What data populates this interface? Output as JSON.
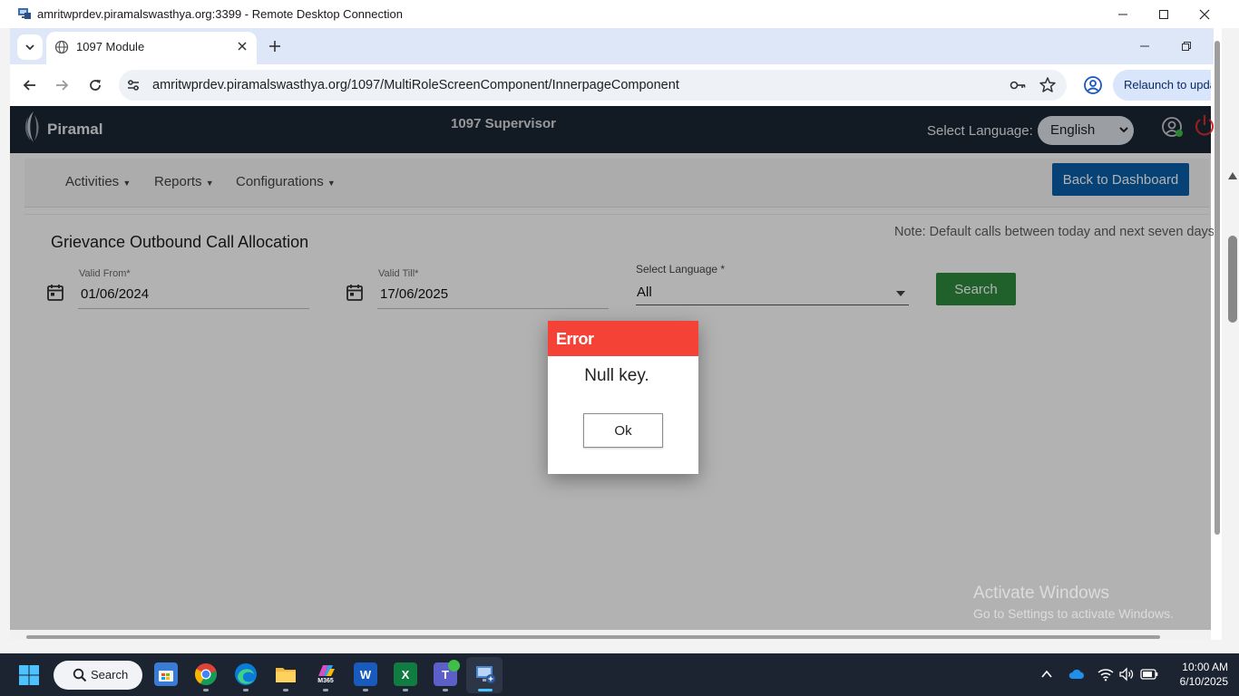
{
  "rdp": {
    "title": "amritwprdev.piramalswasthya.org:3399 - Remote Desktop Connection"
  },
  "browser": {
    "tab_title": "1097 Module",
    "url": "amritwprdev.piramalswasthya.org/1097/MultiRoleScreenComponent/InnerpageComponent",
    "relaunch_label": "Relaunch to update"
  },
  "header": {
    "logo_text": "Piramal",
    "app_title": "1097 Supervisor",
    "language_label": "Select Language:",
    "language_value": "English"
  },
  "menu": {
    "items": [
      "Activities",
      "Reports",
      "Configurations"
    ],
    "back_button": "Back to Dashboard"
  },
  "form": {
    "title": "Grievance Outbound Call Allocation",
    "note": "Note: Default calls between today and next seven days",
    "valid_from_label": "Valid From*",
    "valid_from_value": "01/06/2024",
    "valid_till_label": "Valid Till*",
    "valid_till_value": "17/06/2025",
    "language_label": "Select Language *",
    "language_value": "All",
    "search_button": "Search"
  },
  "dialog": {
    "title": "Error",
    "message": "Null key.",
    "ok_button": "Ok"
  },
  "watermark": {
    "title": "Activate Windows",
    "subtitle": "Go to Settings to activate Windows."
  },
  "taskbar": {
    "search_label": "Search",
    "m365_label": "M365",
    "word_letter": "W",
    "excel_letter": "X",
    "teams_letter": "T",
    "time": "10:00 AM",
    "date": "6/10/2025"
  },
  "colors": {
    "header_bg": "#1b2634",
    "back_button": "#0a5fa8",
    "search_button": "#2e8b3e",
    "dialog_header": "#f44336",
    "taskbar_bg": "#1c2431"
  }
}
